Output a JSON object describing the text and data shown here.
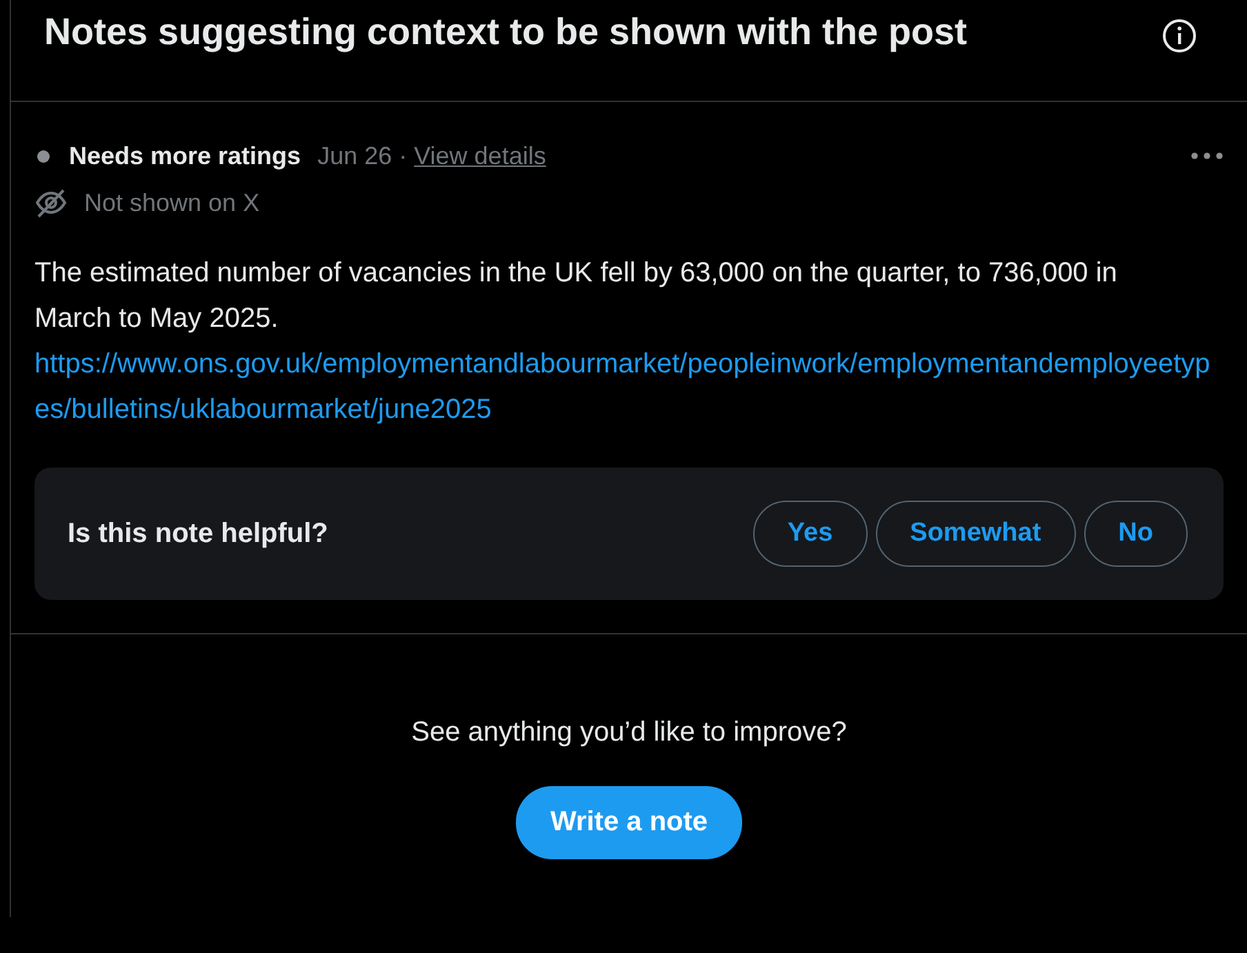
{
  "header": {
    "title": "Notes suggesting context to be shown with the post"
  },
  "note": {
    "status": "Needs more ratings",
    "date": "Jun 26",
    "separator": "·",
    "details_link": "View details",
    "visibility": "Not shown on X",
    "text": "The estimated number of vacancies in the UK fell by 63,000 on the quarter, to 736,000 in March to May 2025.",
    "link": "https://www.ons.gov.uk/employmentandlabourmarket/peopleinwork/employmentandemployeetypes/bulletins/uklabourmarket/june2025"
  },
  "rating": {
    "question": "Is this note helpful?",
    "options": [
      "Yes",
      "Somewhat",
      "No"
    ]
  },
  "footer": {
    "prompt": "See anything you’d like to improve?",
    "button": "Write a note"
  }
}
